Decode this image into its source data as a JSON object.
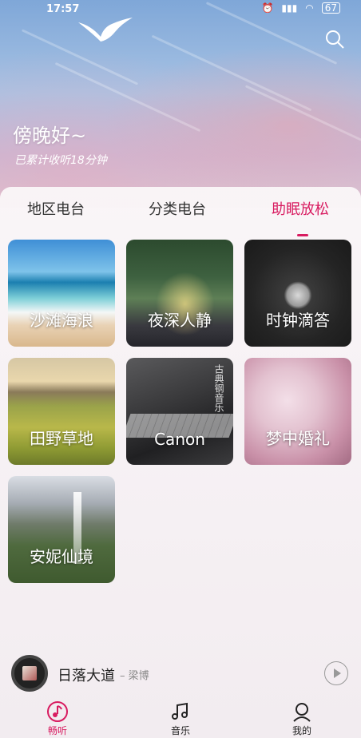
{
  "status_bar": {
    "time": "17:57",
    "battery": "67"
  },
  "header": {
    "greeting": "傍晚好~",
    "listened": "已累计收听18分钟"
  },
  "tabs": [
    {
      "label": "地区电台"
    },
    {
      "label": "分类电台"
    },
    {
      "label": "助眠放松",
      "active": true
    }
  ],
  "cards": [
    {
      "label": "沙滩海浪"
    },
    {
      "label": "夜深人静"
    },
    {
      "label": "时钟滴答"
    },
    {
      "label": "田野草地"
    },
    {
      "label": "Canon",
      "overlay": "古典钢音乐"
    },
    {
      "label": "梦中婚礼"
    },
    {
      "label": "安妮仙境"
    }
  ],
  "player": {
    "song": "日落大道",
    "artist": "– 梁博"
  },
  "bottom_nav": [
    {
      "label": "畅听",
      "icon": "listen-icon",
      "active": true
    },
    {
      "label": "音乐",
      "icon": "music-note-icon"
    },
    {
      "label": "我的",
      "icon": "profile-icon"
    }
  ],
  "colors": {
    "accent": "#d81b60"
  }
}
